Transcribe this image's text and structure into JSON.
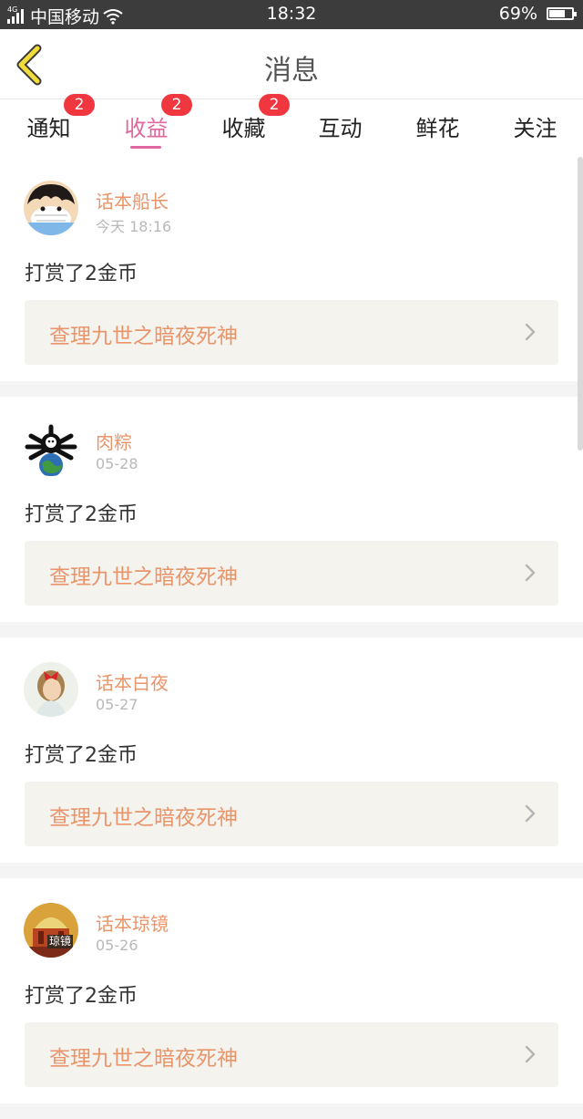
{
  "status_bar": {
    "network": "4G",
    "carrier": "中国移动",
    "time": "18:32",
    "battery": "69%",
    "battery_level": 0.69
  },
  "header": {
    "title": "消息"
  },
  "tabs": [
    {
      "label": "通知",
      "badge": "2"
    },
    {
      "label": "收益",
      "badge": "2",
      "active": true
    },
    {
      "label": "收藏",
      "badge": "2"
    },
    {
      "label": "互动"
    },
    {
      "label": "鲜花"
    },
    {
      "label": "关注"
    }
  ],
  "colors": {
    "accent": "#e0689d",
    "name": "#e9956b",
    "badge": "#f0373f",
    "link_bg": "#f5f3ed"
  },
  "messages": [
    {
      "user": "话本船长",
      "time": "今天 18:16",
      "action": "打赏了2金币",
      "work": "查理九世之暗夜死神",
      "avatar_icon": "straw-hat-boy-avatar"
    },
    {
      "user": "肉粽",
      "time": "05-28",
      "action": "打赏了2金币",
      "work": "查理九世之暗夜死神",
      "avatar_icon": "skull-globe-avatar"
    },
    {
      "user": "话本白夜",
      "time": "05-27",
      "action": "打赏了2金币",
      "work": "查理九世之暗夜死神",
      "avatar_icon": "girl-red-bow-avatar"
    },
    {
      "user": "话本琼镜",
      "time": "05-26",
      "action": "打赏了2金币",
      "work": "查理九世之暗夜死神",
      "avatar_icon": "dome-building-avatar",
      "avatar_text": "琼镜"
    }
  ]
}
